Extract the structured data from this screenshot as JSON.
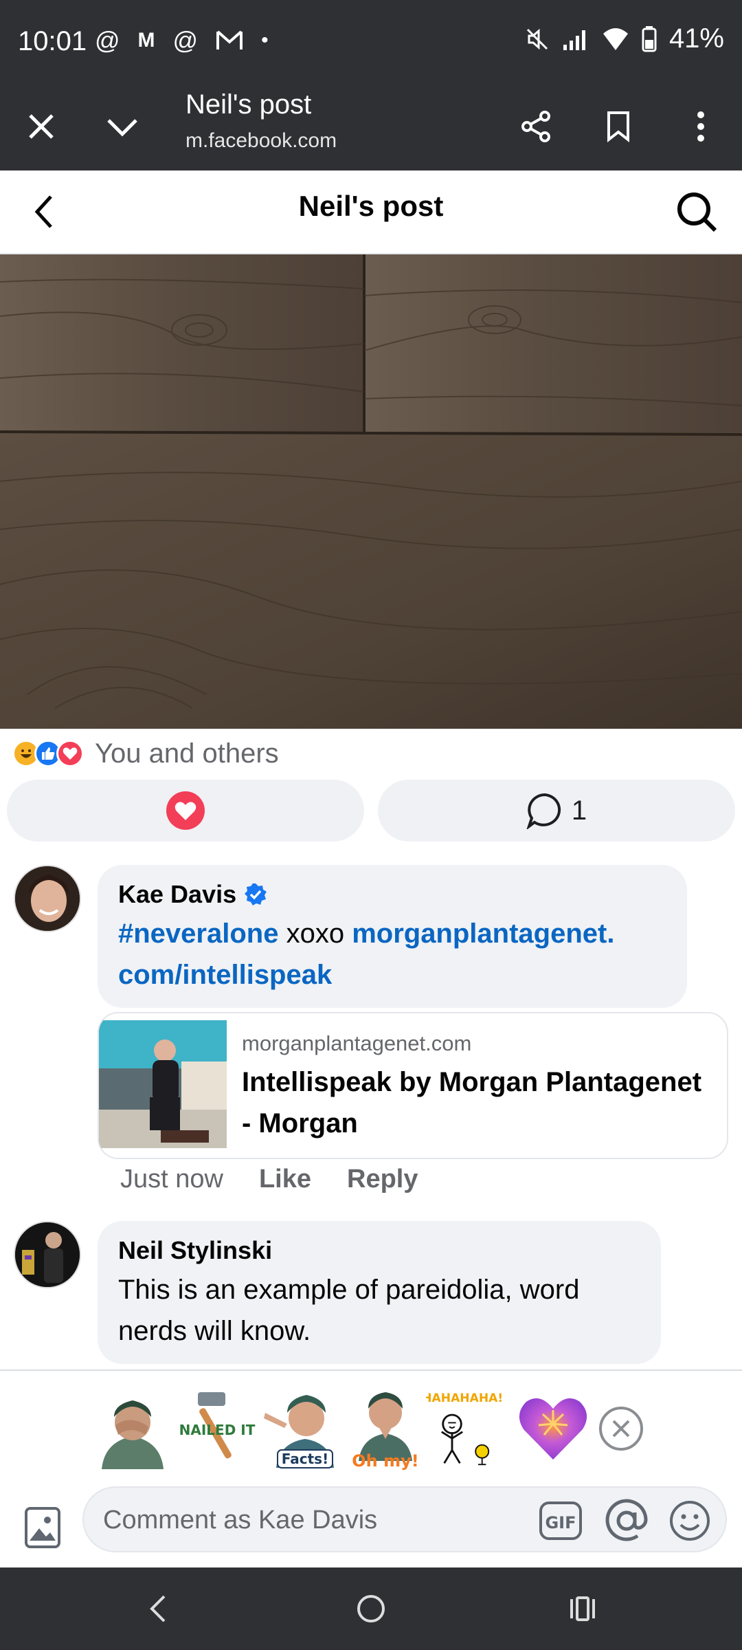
{
  "status_bar": {
    "time": "10:01",
    "battery": "41%",
    "icons_left": [
      "threads-icon",
      "medium-icon",
      "threads-icon",
      "gmail-icon",
      "dot-icon"
    ],
    "icons_right": [
      "mute-icon",
      "signal-icon",
      "wifi-icon",
      "battery-icon"
    ]
  },
  "browser": {
    "title": "Neil's post",
    "url": "m.facebook.com"
  },
  "header": {
    "title": "Neil's post"
  },
  "reactions": {
    "summary": "You and others",
    "comment_count": "1",
    "colors": {
      "haha": "#f7b125",
      "like": "#1877f2",
      "love": "#f33e58"
    }
  },
  "comments": [
    {
      "author": "Kae Davis",
      "verified": true,
      "hashtag": "#neveralone",
      "text": " xoxo ",
      "link": "morganplantagenet.com/intellispeak",
      "link_line1": "morganplantagenet.",
      "link_line2": "com/intellispeak",
      "preview": {
        "domain": "morganplantagenet.com",
        "title": "Intellispeak by Morgan Plantagenet - Morgan"
      },
      "time": "Just now",
      "like_label": "Like",
      "reply_label": "Reply"
    },
    {
      "author": "Neil Stylinski",
      "text": "This is an example of pareidolia, word nerds will know."
    }
  ],
  "stickers": [
    {
      "name": "sticker-facepalm"
    },
    {
      "name": "sticker-nailed-it",
      "caption": "NAILED IT"
    },
    {
      "name": "sticker-facts",
      "caption": "Facts!"
    },
    {
      "name": "sticker-oh-my",
      "caption": "Oh my!"
    },
    {
      "name": "sticker-hahaha",
      "caption": "HAHAHAHA!"
    },
    {
      "name": "sticker-heart"
    }
  ],
  "composer": {
    "placeholder": "Comment as Kae Davis"
  },
  "accent": "#0a66c2"
}
